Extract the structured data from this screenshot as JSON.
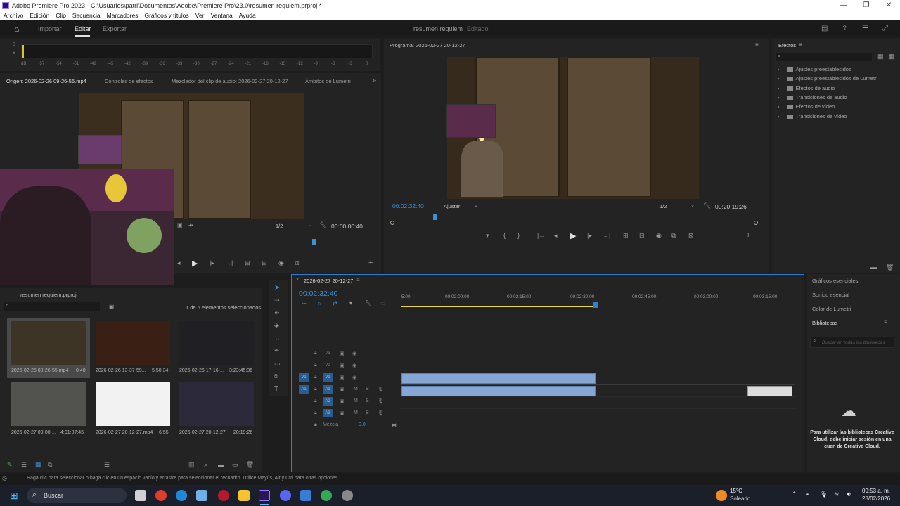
{
  "window": {
    "title": "Adobe Premiere Pro 2023 - C:\\Usuarios\\patri\\Documentos\\Adobe\\Premiere Pro\\23.0\\resumen requiem.prproj *",
    "controls": [
      "—",
      "❐",
      "✕"
    ]
  },
  "menu": [
    "Archivo",
    "Edición",
    "Clip",
    "Secuencia",
    "Marcadores",
    "Gráficos y títulos",
    "Ver",
    "Ventana",
    "Ayuda"
  ],
  "workspace": {
    "tabs": [
      "Importar",
      "Editar",
      "Exportar"
    ],
    "active_tab": "Editar",
    "project_title": "resumen requiem",
    "project_status": "Editado"
  },
  "audio_meter": {
    "ticks": [
      "dB",
      "-57",
      "-54",
      "-51",
      "-48",
      "-45",
      "-42",
      "-39",
      "-36",
      "-33",
      "-30",
      "-27",
      "-24",
      "-21",
      "-18",
      "-15",
      "-12",
      "-9",
      "-6",
      "-3",
      "0"
    ],
    "channels": [
      "S",
      "S"
    ]
  },
  "source_panel": {
    "tabs": [
      "Origen: 2026-02-26 09-26-55.mp4",
      "Controles de efectos",
      "Mezclador del clip de audio: 2026-02-27 20-12-27",
      "Ámbitos de Lumetri"
    ],
    "resolution": "1/2",
    "timecode": "00:00:00:40"
  },
  "program_panel": {
    "title": "Programa: 2026-02-27 20-12-27",
    "timecode": "00:02:32:40",
    "fit": "Ajustar",
    "resolution": "1/2",
    "duration": "00:20:19:26"
  },
  "effects_panel": {
    "title": "Efectos",
    "items": [
      "Ajustes preestablecidos",
      "Ajustes preestablecidos de Lumetri",
      "Efectos de audio",
      "Transiciones de audio",
      "Efectos de vídeo",
      "Transiciones de vídeo"
    ]
  },
  "project_panel": {
    "tab": "resumen requiem.prproj",
    "selection_info": "1 de 6 elementos seleccionados",
    "items": [
      {
        "name": "2026-02-26 09-26-55.mp4",
        "duration": "0:40"
      },
      {
        "name": "2026-02-26 13-37-59...",
        "duration": "5:50:34"
      },
      {
        "name": "2026-02-26 17-16-...",
        "duration": "3:23:45:36"
      },
      {
        "name": "2026-02-27 09-00-...",
        "duration": "4:01:07:45"
      },
      {
        "name": "2026-02-27 20-12-27.mp4",
        "duration": "6:55"
      },
      {
        "name": "2026-02-27 20-12-27",
        "duration": "20:19:26"
      }
    ]
  },
  "timeline": {
    "sequence_tab": "2026-02-27 20-12-27",
    "timecode": "00:02:32:40",
    "ruler": [
      "5:00",
      "00:02:00:00",
      "00:02:15:00",
      "00:02:30:00",
      "00:02:45:00",
      "00:03:00:00",
      "00:03:15:00"
    ],
    "video_tracks": [
      "V3",
      "V2",
      "V1"
    ],
    "audio_tracks": [
      "A1",
      "A2",
      "A3"
    ],
    "source_patch_v": "V1",
    "source_patch_a": "A1",
    "mix_label": "Mezcla",
    "mix_value": "0.0"
  },
  "right_panel": {
    "items": [
      "Gráficos esenciales",
      "Sonido esencial",
      "Color de Lumetri",
      "Bibliotecas"
    ],
    "search_placeholder": "Buscar en todas las bibliotecas",
    "cc_message": "Para utilizar las bibliotecas Creative Cloud, debe iniciar sesión en una cuen de Creative Cloud."
  },
  "status_bar": {
    "hint": "Haga clic para seleccionar o haga clic en un espacio vacío y arrastre para seleccionar el recuadro. Utilice Mayús, Alt y Ctrl para otras opciones."
  },
  "taskbar": {
    "search": "Buscar",
    "weather_temp": "15°C",
    "weather_desc": "Soleado",
    "time": "09:53 a. m.",
    "date": "28/02/2026"
  },
  "colors": {
    "accent_blue": "#3d8fd6",
    "clip_blue": "#86a7d6",
    "playhead": "#2f7fd1",
    "panel_bg": "#232323"
  }
}
